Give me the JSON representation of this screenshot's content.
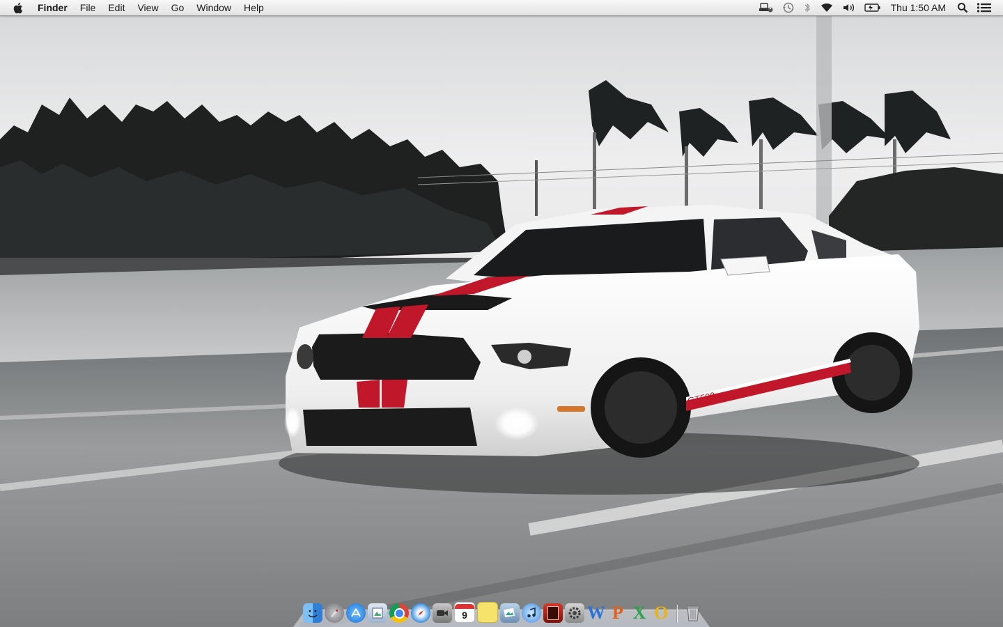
{
  "menubar": {
    "apple_icon": "apple-logo-icon",
    "app_name": "Finder",
    "menus": [
      "File",
      "Edit",
      "View",
      "Go",
      "Window",
      "Help"
    ],
    "status_icons": [
      "menu-extra-icon",
      "time-machine-icon",
      "bluetooth-icon",
      "wifi-icon",
      "volume-icon",
      "battery-icon"
    ],
    "clock": "Thu 1:50 AM",
    "spotlight_icon": "spotlight-search-icon",
    "notification_icon": "notification-center-icon"
  },
  "desktop": {
    "wallpaper": "white-mustang-shelby-gt500-on-highway",
    "car_badge": "GT500"
  },
  "dock": {
    "apps": [
      {
        "name": "Finder",
        "icon": "finder-icon"
      },
      {
        "name": "Launchpad",
        "icon": "launchpad-icon"
      },
      {
        "name": "App Store",
        "icon": "app-store-icon"
      },
      {
        "name": "Preview",
        "icon": "preview-icon"
      },
      {
        "name": "Google Chrome",
        "icon": "chrome-icon"
      },
      {
        "name": "Safari",
        "icon": "safari-icon"
      },
      {
        "name": "FaceTime",
        "icon": "facetime-icon"
      },
      {
        "name": "Calendar",
        "icon": "calendar-icon",
        "date": "9"
      },
      {
        "name": "Stickies",
        "icon": "stickies-icon"
      },
      {
        "name": "iPhoto",
        "icon": "iphoto-icon"
      },
      {
        "name": "iTunes",
        "icon": "itunes-icon"
      },
      {
        "name": "Photo Booth",
        "icon": "photo-booth-icon"
      },
      {
        "name": "System Preferences",
        "icon": "system-preferences-icon"
      },
      {
        "name": "Word",
        "icon": "word-icon",
        "glyph": "W"
      },
      {
        "name": "PowerPoint",
        "icon": "powerpoint-icon",
        "glyph": "P"
      },
      {
        "name": "Excel",
        "icon": "excel-icon",
        "glyph": "X"
      },
      {
        "name": "Outlook",
        "icon": "outlook-icon",
        "glyph": "O"
      }
    ],
    "trash": {
      "name": "Trash",
      "icon": "trash-icon"
    }
  },
  "colors": {
    "menubar_bg": "#ececec",
    "car_white": "#f2f2f2",
    "stripe_red": "#c0182a",
    "sky": "#e9e9ea",
    "road": "#8a8d8f",
    "trees": "#1e2020"
  }
}
